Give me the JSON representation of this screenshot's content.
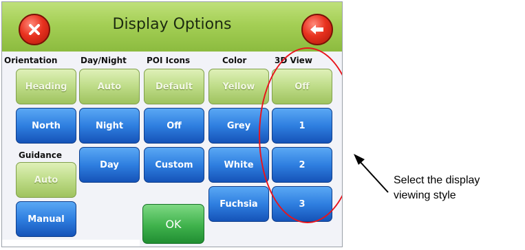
{
  "window": {
    "title": "Display Options"
  },
  "header": {
    "close_icon": "close-icon",
    "back_icon": "back-arrow-icon",
    "accent_color": "#a4cf55"
  },
  "columns": [
    {
      "header": "Orientation",
      "options": [
        "Heading",
        "North"
      ],
      "selected": "Heading"
    },
    {
      "header": "Day/Night",
      "options": [
        "Auto",
        "Night",
        "Day"
      ],
      "selected": "Auto"
    },
    {
      "header": "POI Icons",
      "options": [
        "Default",
        "Off",
        "Custom"
      ],
      "selected": "Default"
    },
    {
      "header": "Color",
      "options": [
        "Yellow",
        "Grey",
        "White",
        "Fuchsia"
      ],
      "selected": "Yellow"
    },
    {
      "header": "3D View",
      "options": [
        "Off",
        "1",
        "2",
        "3"
      ],
      "selected": "Off"
    }
  ],
  "guidance": {
    "header": "Guidance",
    "options": [
      "Auto",
      "Manual"
    ],
    "selected": "Auto"
  },
  "ok_label": "OK",
  "annotation": {
    "line1": "Select the display",
    "line2": "viewing style",
    "highlight_color": "#e8141c"
  }
}
